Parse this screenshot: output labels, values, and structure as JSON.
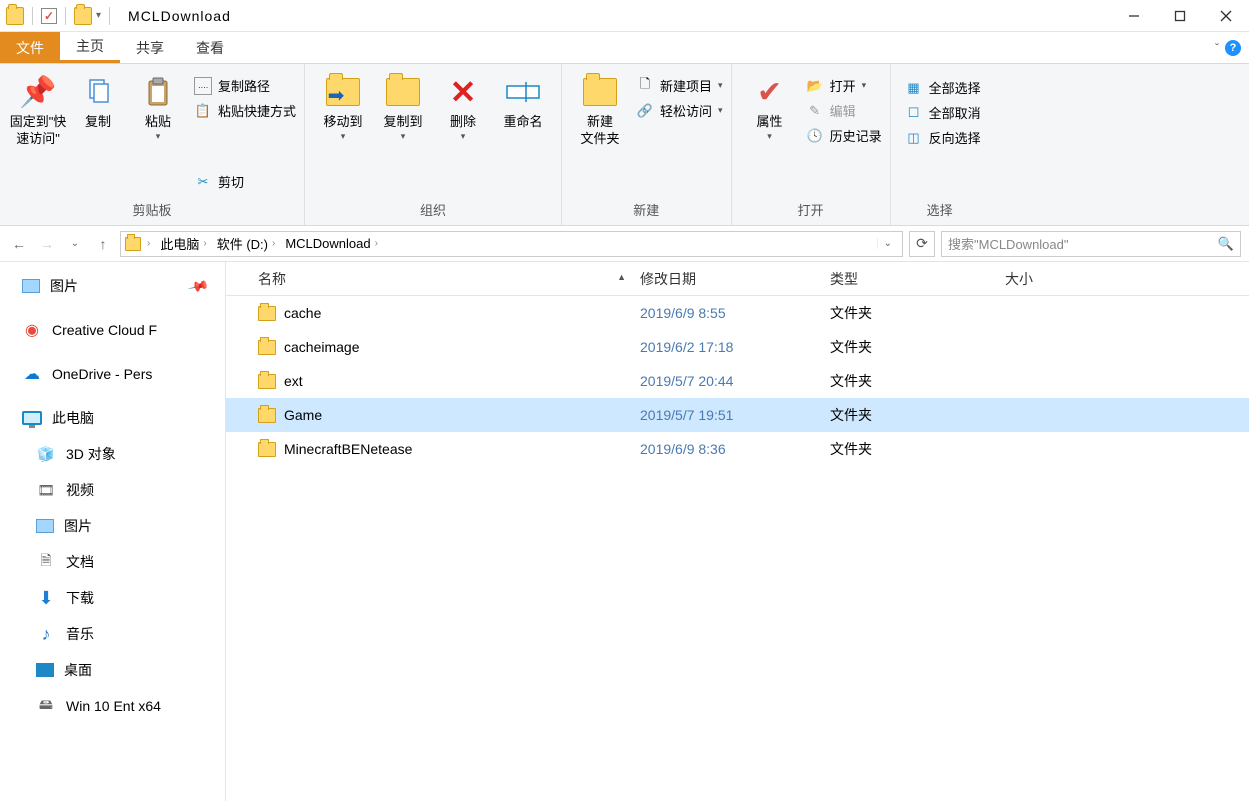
{
  "window": {
    "title": "MCLDownload"
  },
  "tabs": {
    "file": "文件",
    "home": "主页",
    "share": "共享",
    "view": "查看"
  },
  "ribbon": {
    "clipboard": {
      "pin": "固定到\"快\n速访问\"",
      "copy": "复制",
      "paste": "粘贴",
      "copypath": "复制路径",
      "pasteshortcut": "粘贴快捷方式",
      "cut": "剪切",
      "label": "剪贴板"
    },
    "organize": {
      "moveto": "移动到",
      "copyto": "复制到",
      "delete": "删除",
      "rename": "重命名",
      "label": "组织"
    },
    "new_": {
      "newfolder": "新建\n文件夹",
      "newitem": "新建项目",
      "easyaccess": "轻松访问",
      "label": "新建"
    },
    "open": {
      "properties": "属性",
      "open": "打开",
      "edit": "编辑",
      "history": "历史记录",
      "label": "打开"
    },
    "select": {
      "selectall": "全部选择",
      "selectnone": "全部取消",
      "invert": "反向选择",
      "label": "选择"
    }
  },
  "breadcrumb": {
    "pc": "此电脑",
    "drive": "软件 (D:)",
    "folder": "MCLDownload"
  },
  "search": {
    "placeholder": "搜索\"MCLDownload\""
  },
  "columns": {
    "name": "名称",
    "date": "修改日期",
    "type": "类型",
    "size": "大小"
  },
  "files": [
    {
      "name": "cache",
      "date": "2019/6/9 8:55",
      "type": "文件夹",
      "selected": false
    },
    {
      "name": "cacheimage",
      "date": "2019/6/2 17:18",
      "type": "文件夹",
      "selected": false
    },
    {
      "name": "ext",
      "date": "2019/5/7 20:44",
      "type": "文件夹",
      "selected": false
    },
    {
      "name": "Game",
      "date": "2019/5/7 19:51",
      "type": "文件夹",
      "selected": true
    },
    {
      "name": "MinecraftBENetease",
      "date": "2019/6/9 8:36",
      "type": "文件夹",
      "selected": false
    }
  ],
  "sidebar": {
    "pictures": "图片",
    "cc": "Creative Cloud F",
    "onedrive": "OneDrive - Pers",
    "thispc": "此电脑",
    "objects3d": "3D 对象",
    "videos": "视频",
    "pictures2": "图片",
    "documents": "文档",
    "downloads": "下载",
    "music": "音乐",
    "desktop": "桌面",
    "win10": "Win 10 Ent x64"
  }
}
